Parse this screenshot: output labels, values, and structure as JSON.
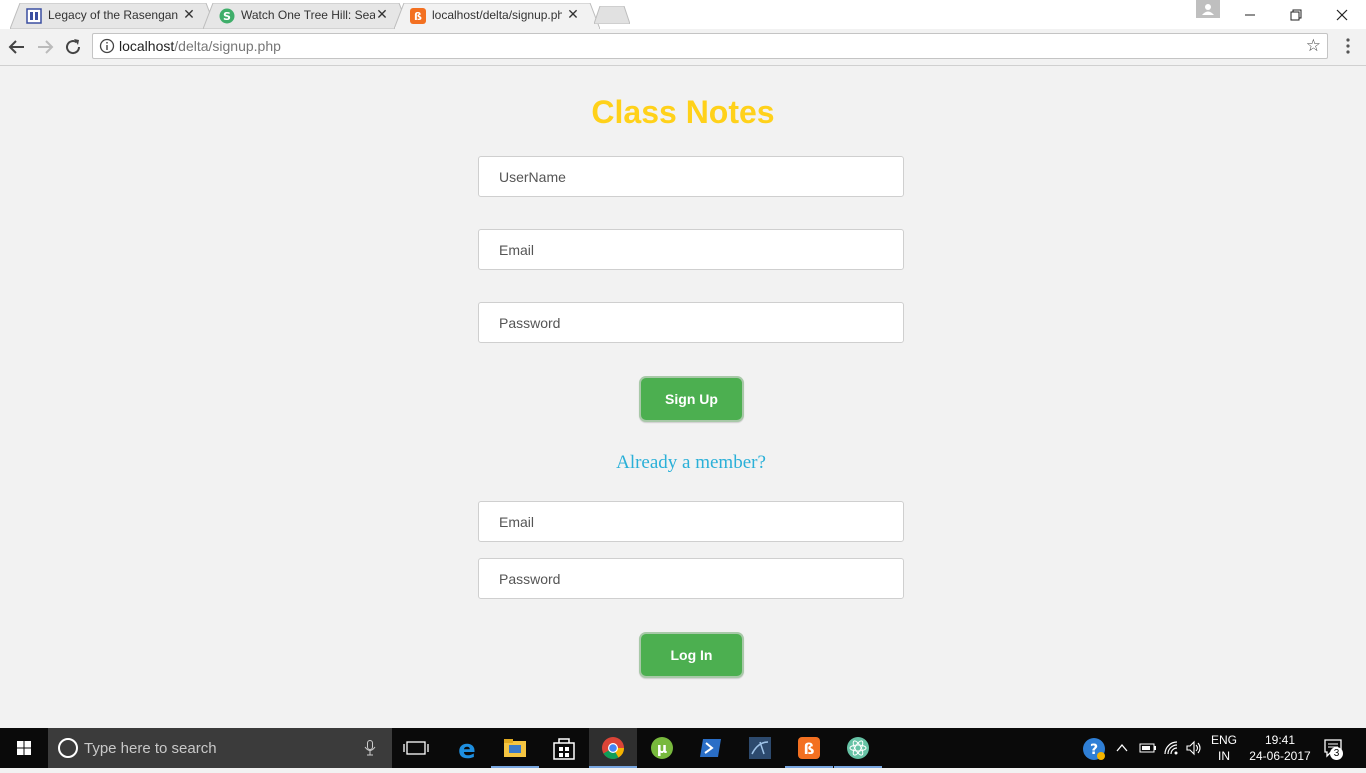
{
  "browser": {
    "tabs": [
      {
        "title": "Legacy of the Rasengan | ",
        "icon": "page-icon",
        "active": false
      },
      {
        "title": "Watch One Tree Hill: Sea",
        "icon": "site-s-icon",
        "active": false
      },
      {
        "title": "localhost/delta/signup.ph",
        "icon": "xampp-icon",
        "active": true
      }
    ],
    "url_host": "localhost",
    "url_path": "/delta/signup.php"
  },
  "page": {
    "title": "Class Notes",
    "signup": {
      "username_placeholder": "UserName",
      "email_placeholder": "Email",
      "password_placeholder": "Password",
      "button": "Sign Up"
    },
    "already_member": "Already a member?",
    "login": {
      "email_placeholder": "Email",
      "password_placeholder": "Password",
      "button": "Log In"
    }
  },
  "taskbar": {
    "search_placeholder": "Type here to search",
    "lang_top": "ENG",
    "lang_bottom": "IN",
    "time": "19:41",
    "date": "24-06-2017",
    "notification_count": "3"
  },
  "colors": {
    "title": "#ffd11a",
    "button": "#4caf50",
    "link": "#2ab0d8"
  }
}
